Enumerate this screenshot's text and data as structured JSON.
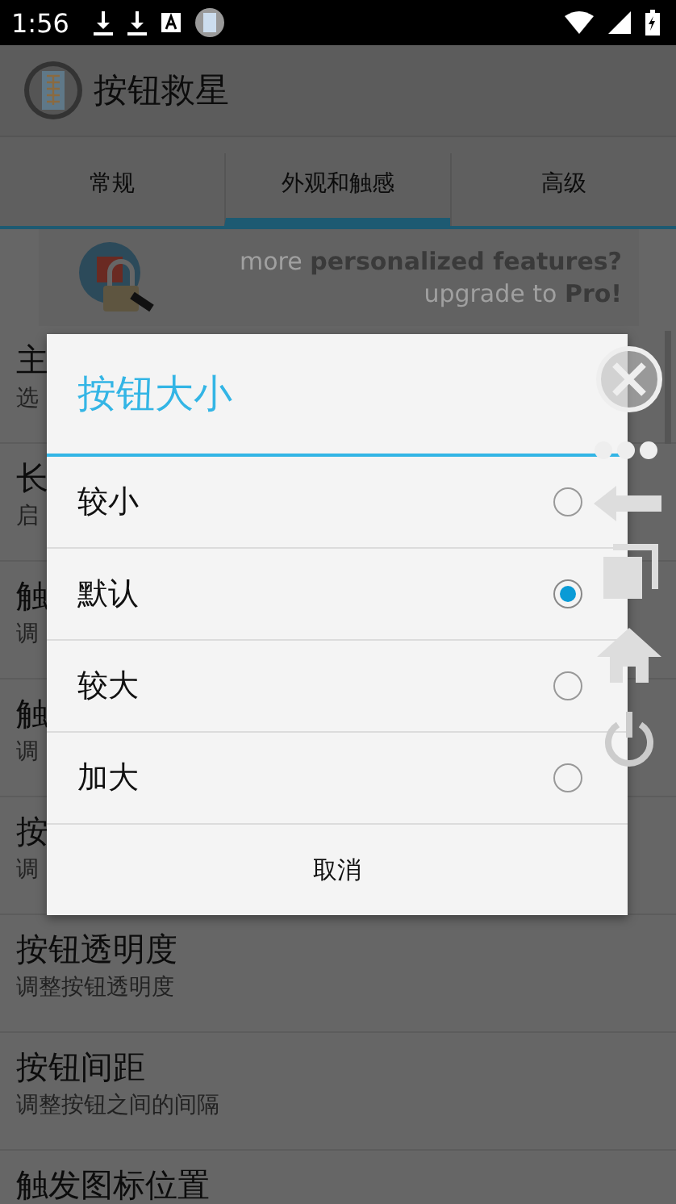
{
  "status_bar": {
    "time": "1:56"
  },
  "app_bar": {
    "title": "按钮救星"
  },
  "tabs": [
    {
      "label": "常规",
      "selected": false
    },
    {
      "label": "外观和触感",
      "selected": true
    },
    {
      "label": "高级",
      "selected": false
    }
  ],
  "banner": {
    "line_1": "more **personalized features?**",
    "line_2": "upgrade to **Pro!**"
  },
  "settings": [
    {
      "title": "主",
      "subtitle": "选"
    },
    {
      "title": "长",
      "subtitle": "启"
    },
    {
      "title": "触",
      "subtitle": "调"
    },
    {
      "title": "触",
      "subtitle": "调"
    },
    {
      "title": "按",
      "subtitle": "调"
    },
    {
      "title": "按钮透明度",
      "subtitle": "调整按钮透明度"
    },
    {
      "title": "按钮间距",
      "subtitle": "调整按钮之间的间隔"
    },
    {
      "title": "触发图标位置"
    }
  ],
  "dialog": {
    "title": "按钮大小",
    "options": [
      {
        "label": "较小",
        "selected": false
      },
      {
        "label": "默认",
        "selected": true
      },
      {
        "label": "较大",
        "selected": false
      },
      {
        "label": "加大",
        "selected": false
      }
    ],
    "cancel": "取消"
  }
}
